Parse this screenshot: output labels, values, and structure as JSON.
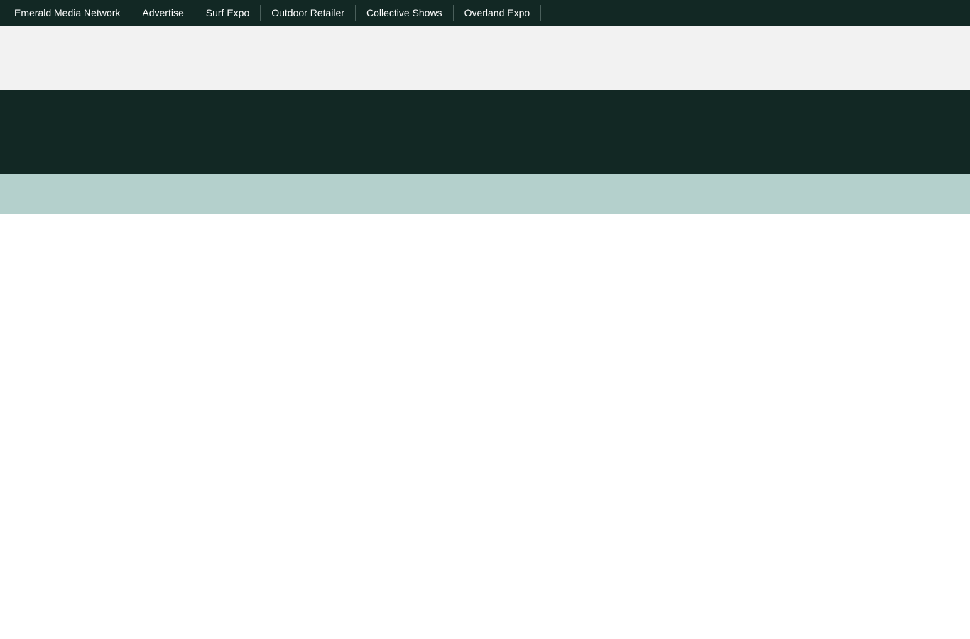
{
  "top_nav": {
    "items": [
      {
        "label": "Emerald Media Network"
      },
      {
        "label": "Advertise"
      },
      {
        "label": "Surf Expo"
      },
      {
        "label": "Outdoor Retailer"
      },
      {
        "label": "Collective Shows"
      },
      {
        "label": "Overland Expo"
      }
    ]
  },
  "colors": {
    "nav_background": "#122824",
    "ad_band": "#f2f2f2",
    "header_band": "#122824",
    "sub_band": "#b4d0cc"
  }
}
